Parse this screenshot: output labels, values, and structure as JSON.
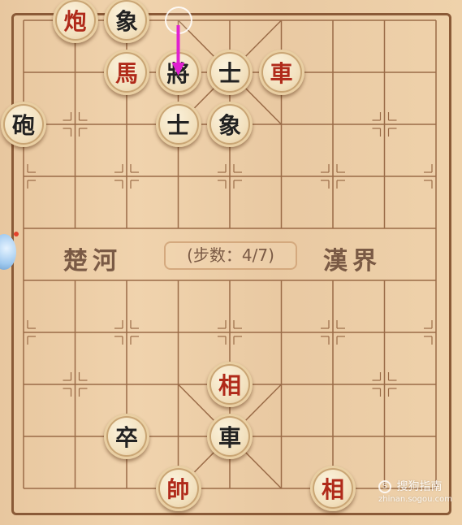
{
  "river": {
    "left": "楚河",
    "right": "漢界"
  },
  "step": {
    "text": "(步数：4/7)"
  },
  "pieces": [
    {
      "char": "炮",
      "side": "red",
      "file": 1,
      "rank": 0
    },
    {
      "char": "象",
      "side": "black",
      "file": 2,
      "rank": 0
    },
    {
      "char": "馬",
      "side": "red",
      "file": 2,
      "rank": 1
    },
    {
      "char": "將",
      "side": "black",
      "file": 3,
      "rank": 1
    },
    {
      "char": "士",
      "side": "black",
      "file": 4,
      "rank": 1
    },
    {
      "char": "車",
      "side": "red",
      "file": 5,
      "rank": 1
    },
    {
      "char": "砲",
      "side": "black",
      "file": 0,
      "rank": 2
    },
    {
      "char": "士",
      "side": "black",
      "file": 3,
      "rank": 2
    },
    {
      "char": "象",
      "side": "black",
      "file": 4,
      "rank": 2
    },
    {
      "char": "相",
      "side": "red",
      "file": 4,
      "rank": 7
    },
    {
      "char": "卒",
      "side": "black",
      "file": 2,
      "rank": 8
    },
    {
      "char": "車",
      "side": "black",
      "file": 4,
      "rank": 8
    },
    {
      "char": "帥",
      "side": "red",
      "file": 3,
      "rank": 9
    },
    {
      "char": "相",
      "side": "red",
      "file": 6,
      "rank": 9
    }
  ],
  "move_arrow": {
    "from_file": 3,
    "from_rank": 0,
    "to_file": 3,
    "to_rank": 1,
    "color": "#e020d0"
  },
  "colors": {
    "red": "#b02a1a",
    "black": "#222222",
    "line": "#9a6b47",
    "arrow": "#e020d0"
  },
  "watermark": {
    "brand": "搜狗指南",
    "url": "zhinan.sogou.com",
    "icon": "S"
  }
}
